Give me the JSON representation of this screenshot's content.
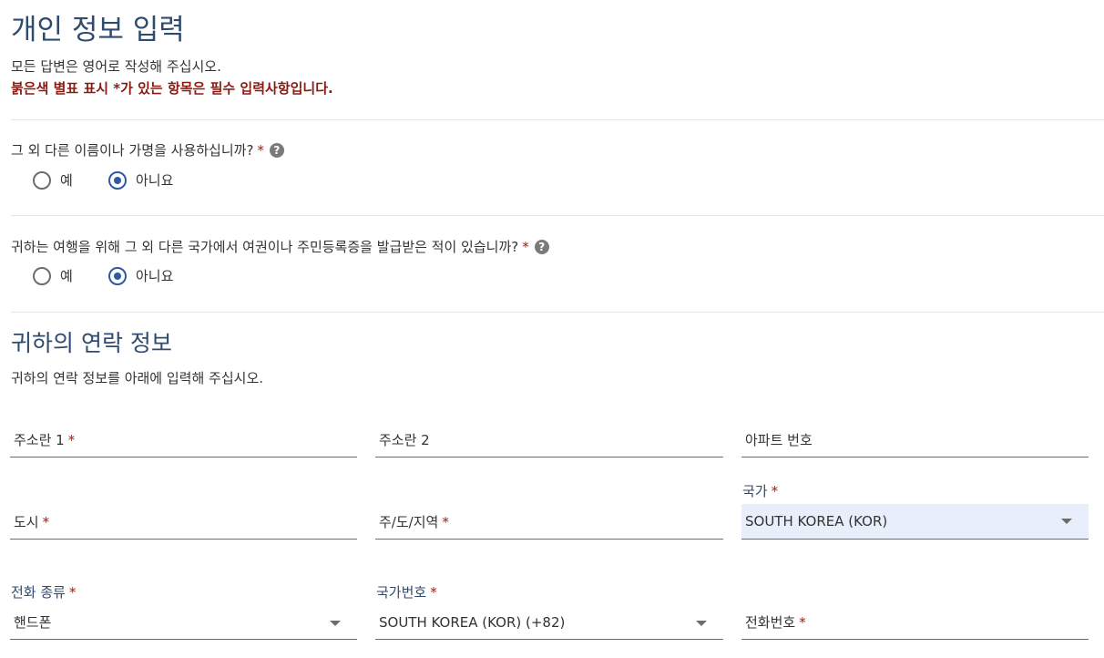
{
  "page_title": "개인 정보 입력",
  "intro_text": "모든 답변은 영어로 작성해 주십시오.",
  "required_note": "붉은색 별표 표시 *가 있는 항목은 필수 입력사항입니다.",
  "required_marker": "*",
  "questions": [
    {
      "label": "그 외 다른 이름이나 가명을 사용하십니까?",
      "help_icon": "?",
      "options": [
        {
          "label": "예",
          "selected": false
        },
        {
          "label": "아니요",
          "selected": true
        }
      ]
    },
    {
      "label": "귀하는 여행을 위해 그 외 다른 국가에서 여권이나 주민등록증을 발급받은 적이 있습니까?",
      "help_icon": "?",
      "options": [
        {
          "label": "예",
          "selected": false
        },
        {
          "label": "아니요",
          "selected": true
        }
      ]
    }
  ],
  "contact": {
    "title": "귀하의 연락 정보",
    "description": "귀하의 연락 정보를 아래에 입력해 주십시오.",
    "fields": {
      "address1": {
        "label": "주소란 1",
        "required": true
      },
      "address2": {
        "label": "주소란 2",
        "required": false
      },
      "apartment": {
        "label": "아파트 번호",
        "required": false
      },
      "city": {
        "label": "도시",
        "required": true
      },
      "state": {
        "label": "주/도/지역",
        "required": true
      },
      "country": {
        "label": "국가",
        "required": true,
        "value": "SOUTH KOREA (KOR)"
      },
      "phone_type": {
        "label": "전화 종류",
        "required": true,
        "value": "핸드폰"
      },
      "country_code": {
        "label": "국가번호",
        "required": true,
        "value": "SOUTH KOREA (KOR) (+82)"
      },
      "phone_number": {
        "label": "전화번호",
        "required": true
      }
    }
  },
  "colors": {
    "heading": "#2f4b6e",
    "required": "#a11d12",
    "required_note": "#8a1b12",
    "radio_selected": "#2d5aa3",
    "filled_field_bg": "#e8effa"
  }
}
